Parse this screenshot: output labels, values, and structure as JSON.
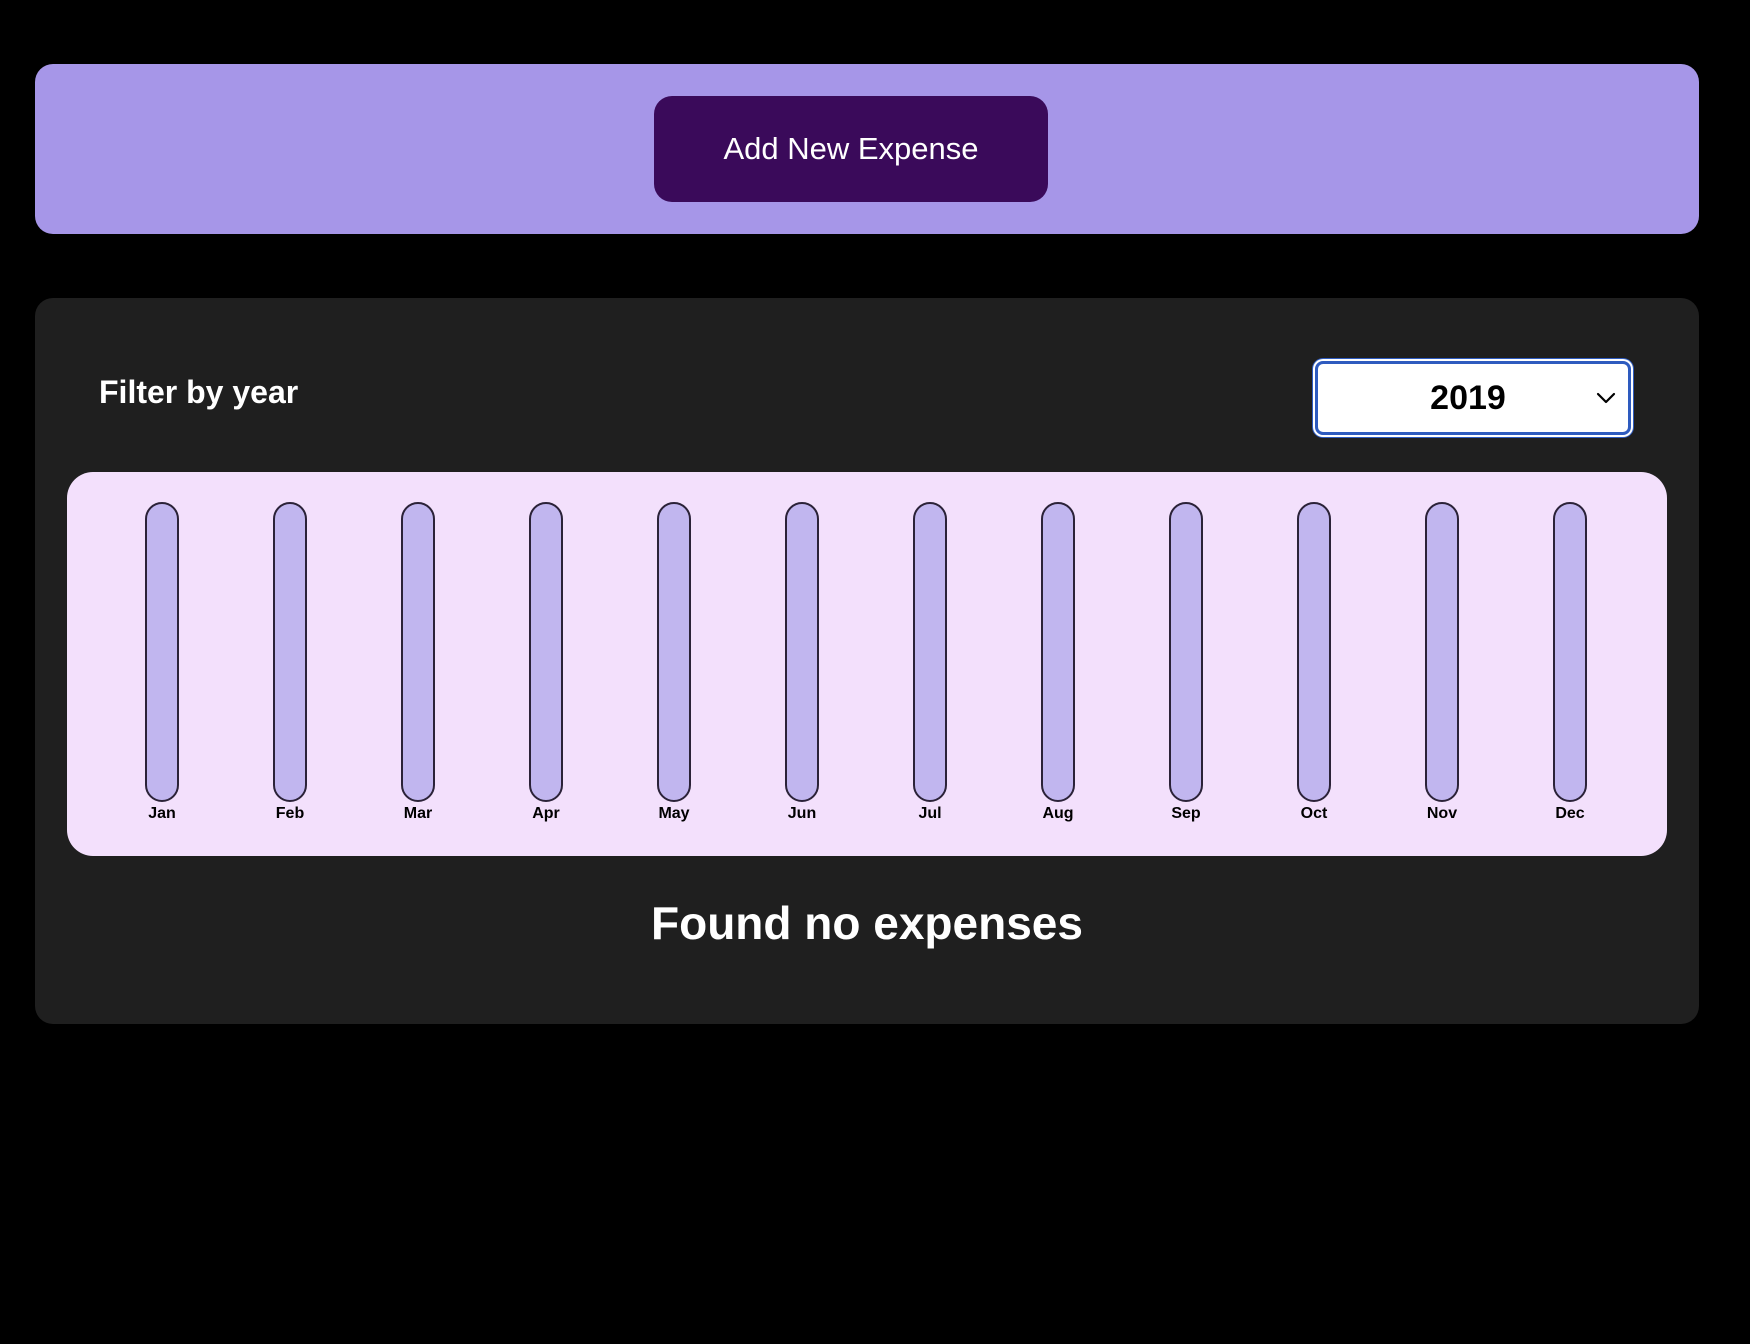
{
  "toolbar": {
    "add_button_label": "Add New Expense"
  },
  "filter": {
    "label": "Filter by year",
    "selected_year": "2019"
  },
  "chart_data": {
    "type": "bar",
    "categories": [
      "Jan",
      "Feb",
      "Mar",
      "Apr",
      "May",
      "Jun",
      "Jul",
      "Aug",
      "Sep",
      "Oct",
      "Nov",
      "Dec"
    ],
    "values": [
      0,
      0,
      0,
      0,
      0,
      0,
      0,
      0,
      0,
      0,
      0,
      0
    ],
    "ylim": [
      0,
      1
    ]
  },
  "expenses": {
    "empty_message": "Found no expenses"
  },
  "colors": {
    "top_panel": "#a696e8",
    "button": "#3a0a5a",
    "main_panel": "#1f1f1f",
    "chart_bg": "#f3e0fc",
    "bar_track": "#c1b6ef",
    "bar_fill": "#4826b9"
  }
}
